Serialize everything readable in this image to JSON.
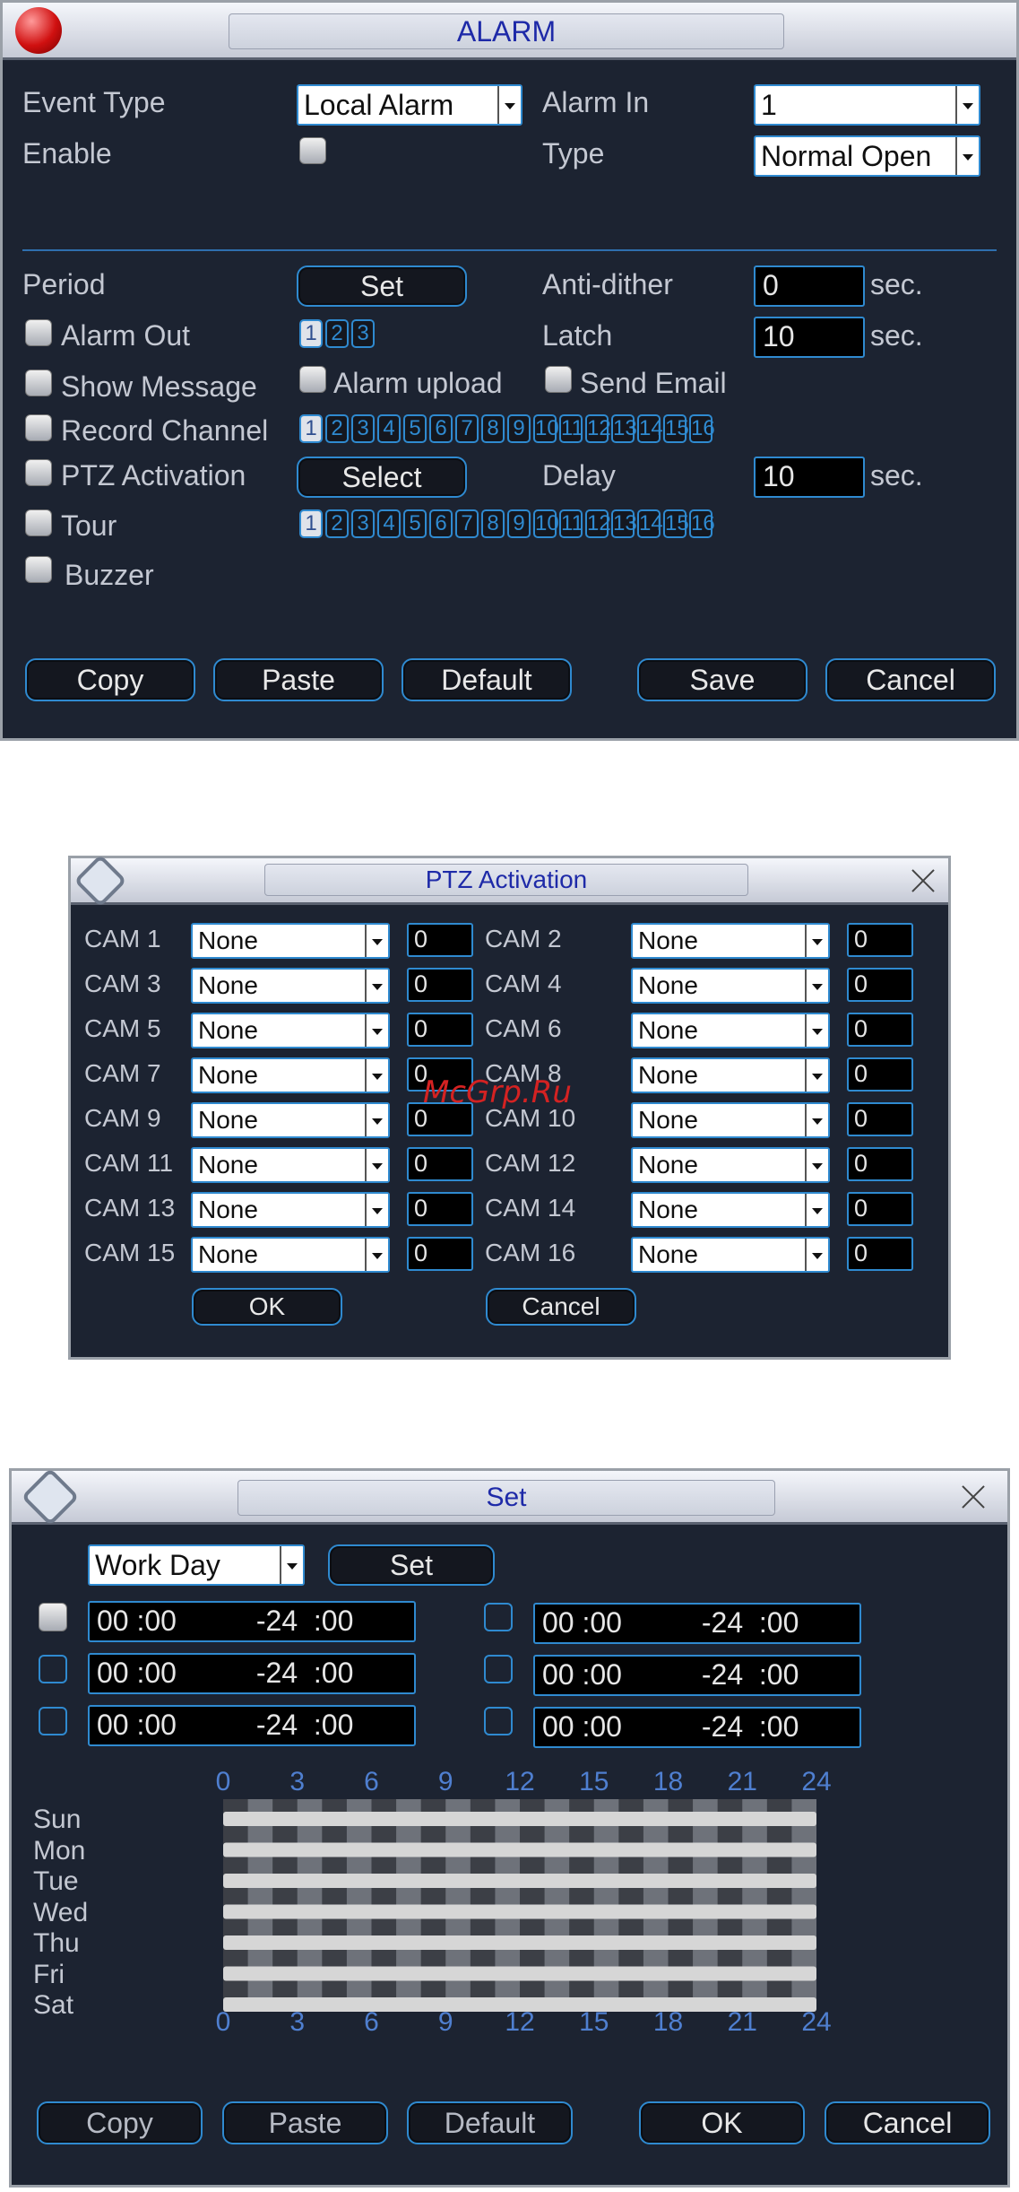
{
  "alarm": {
    "title": "ALARM",
    "event_type_label": "Event Type",
    "event_type_value": "Local Alarm",
    "alarm_in_label": "Alarm In",
    "alarm_in_value": "1",
    "enable_label": "Enable",
    "type_label": "Type",
    "type_value": "Normal Open",
    "period_label": "Period",
    "set_label": "Set",
    "anti_dither_label": "Anti-dither",
    "anti_dither_value": "0",
    "sec": "sec.",
    "alarm_out_label": "Alarm Out",
    "latch_label": "Latch",
    "latch_value": "10",
    "show_message_label": "Show Message",
    "alarm_upload_label": "Alarm upload",
    "send_email_label": "Send Email",
    "record_channel_label": "Record Channel",
    "ptz_activation_label": "PTZ Activation",
    "select_label": "Select",
    "delay_label": "Delay",
    "delay_value": "10",
    "tour_label": "Tour",
    "buzzer_label": "Buzzer",
    "alarm_out_channels": [
      "1",
      "2",
      "3"
    ],
    "channels": [
      "1",
      "2",
      "3",
      "4",
      "5",
      "6",
      "7",
      "8",
      "9",
      "10",
      "11",
      "12",
      "13",
      "14",
      "15",
      "16"
    ],
    "buttons": {
      "copy": "Copy",
      "paste": "Paste",
      "default": "Default",
      "save": "Save",
      "cancel": "Cancel"
    }
  },
  "ptz": {
    "title": "PTZ Activation",
    "rows": [
      {
        "cam_l": "CAM 1",
        "sel_l": "None",
        "val_l": "0",
        "cam_r": "CAM 2",
        "sel_r": "None",
        "val_r": "0"
      },
      {
        "cam_l": "CAM 3",
        "sel_l": "None",
        "val_l": "0",
        "cam_r": "CAM 4",
        "sel_r": "None",
        "val_r": "0"
      },
      {
        "cam_l": "CAM 5",
        "sel_l": "None",
        "val_l": "0",
        "cam_r": "CAM 6",
        "sel_r": "None",
        "val_r": "0"
      },
      {
        "cam_l": "CAM 7",
        "sel_l": "None",
        "val_l": "0",
        "cam_r": "CAM 8",
        "sel_r": "None",
        "val_r": "0"
      },
      {
        "cam_l": "CAM 9",
        "sel_l": "None",
        "val_l": "0",
        "cam_r": "CAM 10",
        "sel_r": "None",
        "val_r": "0"
      },
      {
        "cam_l": "CAM 11",
        "sel_l": "None",
        "val_l": "0",
        "cam_r": "CAM 12",
        "sel_r": "None",
        "val_r": "0"
      },
      {
        "cam_l": "CAM 13",
        "sel_l": "None",
        "val_l": "0",
        "cam_r": "CAM 14",
        "sel_r": "None",
        "val_r": "0"
      },
      {
        "cam_l": "CAM 15",
        "sel_l": "None",
        "val_l": "0",
        "cam_r": "CAM 16",
        "sel_r": "None",
        "val_r": "0"
      }
    ],
    "ok": "OK",
    "cancel": "Cancel"
  },
  "watermark": "McGrp.Ru",
  "set": {
    "title": "Set",
    "day_value": "Work Day",
    "set_button": "Set",
    "periods_left": [
      "00 :00          -24  :00",
      "00 :00          -24  :00",
      "00 :00          -24  :00"
    ],
    "periods_right": [
      "00 :00          -24  :00",
      "00 :00          -24  :00",
      "00 :00          -24  :00"
    ],
    "ticks": [
      "0",
      "3",
      "6",
      "9",
      "12",
      "15",
      "18",
      "21",
      "24"
    ],
    "days": [
      "Sun",
      "Mon",
      "Tue",
      "Wed",
      "Thu",
      "Fri",
      "Sat"
    ],
    "buttons": {
      "copy": "Copy",
      "paste": "Paste",
      "default": "Default",
      "ok": "OK",
      "cancel": "Cancel"
    }
  }
}
